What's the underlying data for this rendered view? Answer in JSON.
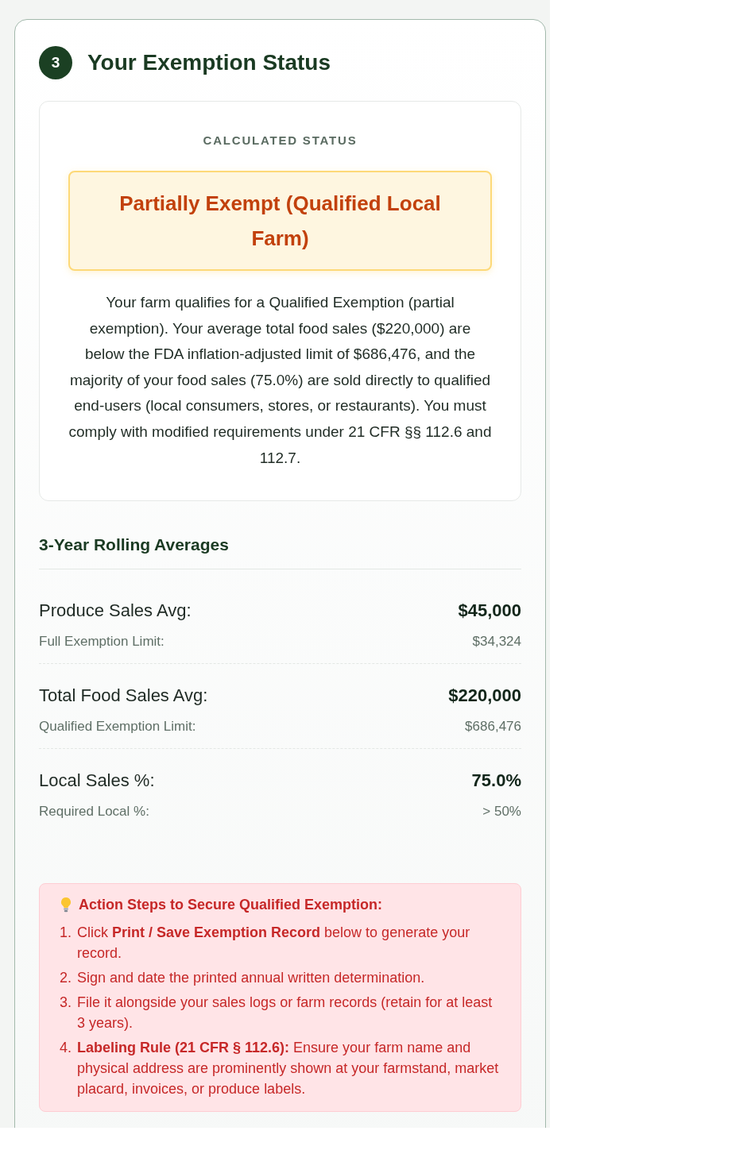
{
  "section": {
    "number": "3",
    "title": "Your Exemption Status"
  },
  "status_card": {
    "label": "CALCULATED STATUS",
    "status": "Partially Exempt (Qualified Local Farm)",
    "explanation": "Your farm qualifies for a Qualified Exemption (partial exemption). Your average total food sales ($220,000) are below the FDA inflation-adjusted limit of $686,476, and the majority of your food sales (75.0%) are sold directly to qualified end-users (local consumers, stores, or restaurants). You must comply with modified requirements under 21 CFR §§ 112.6 and 112.7."
  },
  "averages": {
    "title": "3-Year Rolling Averages",
    "rows": [
      {
        "label": "Produce Sales Avg:",
        "value": "$45,000",
        "limit_label": "Full Exemption Limit:",
        "limit_value": "$34,324"
      },
      {
        "label": "Total Food Sales Avg:",
        "value": "$220,000",
        "limit_label": "Qualified Exemption Limit:",
        "limit_value": "$686,476"
      },
      {
        "label": "Local Sales %:",
        "value": "75.0%",
        "limit_label": "Required Local %:",
        "limit_value": "> 50%"
      }
    ]
  },
  "action_steps": {
    "title": "Action Steps to Secure Qualified Exemption:",
    "steps": [
      {
        "number": "1.",
        "text": "Click **Print / Save Exemption Record** below to generate your record."
      },
      {
        "number": "2.",
        "text": "Sign and date the printed annual written determination."
      },
      {
        "number": "3.",
        "text": "File it alongside your sales logs or farm records (retain for at least 3 years)."
      },
      {
        "number": "4.",
        "text": "**Labeling Rule (21 CFR § 112.6):** Ensure your farm name and physical address are prominently shown at your farmstand, market placard, invoices, or produce labels."
      }
    ]
  }
}
